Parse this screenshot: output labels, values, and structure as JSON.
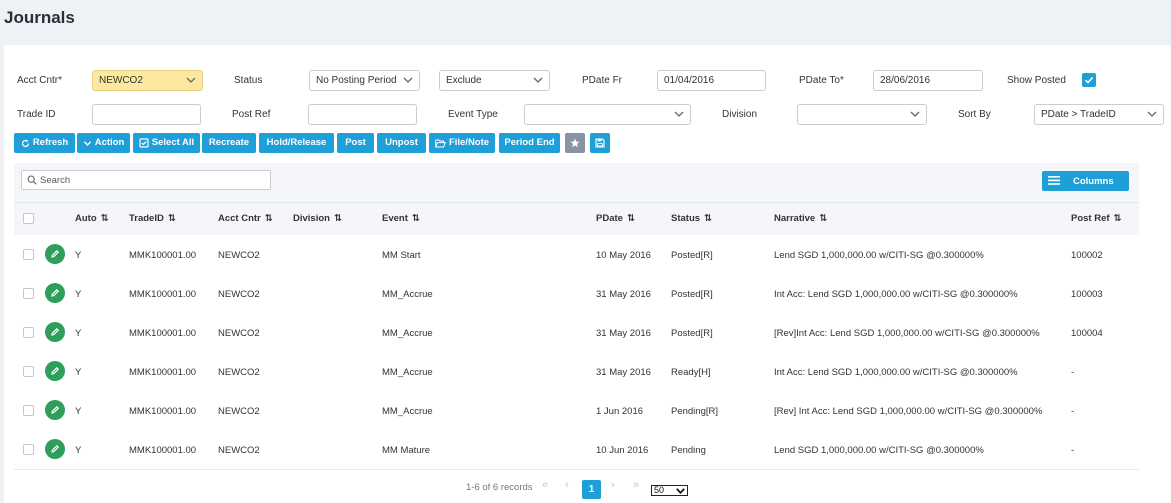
{
  "page": {
    "title": "Journals"
  },
  "filters": {
    "acct_cntr": {
      "label": "Acct Cntr*",
      "value": "NEWCO2"
    },
    "status": {
      "label": "Status",
      "value": "No Posting Period"
    },
    "exclude": {
      "value": "Exclude"
    },
    "pdate_fr": {
      "label": "PDate Fr",
      "value": "01/04/2016"
    },
    "pdate_to": {
      "label": "PDate To*",
      "value": "28/06/2016"
    },
    "show_posted": {
      "label": "Show Posted",
      "checked": true
    },
    "trade_id": {
      "label": "Trade ID",
      "value": ""
    },
    "post_ref": {
      "label": "Post Ref",
      "value": ""
    },
    "event_type": {
      "label": "Event Type",
      "value": ""
    },
    "division": {
      "label": "Division",
      "value": ""
    },
    "sort_by": {
      "label": "Sort By",
      "value": "PDate > TradeID"
    }
  },
  "toolbar": {
    "refresh": "Refresh",
    "action": "Action",
    "select_all": "Select All",
    "recreate": "Recreate",
    "hold_release": "Hold/Release",
    "post": "Post",
    "unpost": "Unpost",
    "file_note": "File/Note",
    "period_end": "Period End"
  },
  "grid": {
    "search_placeholder": "Search",
    "columns_label": "Columns",
    "headers": {
      "auto": "Auto",
      "trade_id": "TradeID",
      "acct_cntr": "Acct Cntr",
      "division": "Division",
      "event": "Event",
      "pdate": "PDate",
      "status": "Status",
      "narrative": "Narrative",
      "post_ref": "Post Ref"
    },
    "rows": [
      {
        "auto": "Y",
        "trade_id": "MMK100001.00",
        "acct_cntr": "NEWCO2",
        "division": "",
        "event": "MM Start",
        "pdate": "10 May 2016",
        "status": "Posted[R]",
        "narrative": "Lend SGD 1,000,000.00 w/CITI-SG @0.300000%",
        "post_ref": "100002"
      },
      {
        "auto": "Y",
        "trade_id": "MMK100001.00",
        "acct_cntr": "NEWCO2",
        "division": "",
        "event": "MM_Accrue",
        "pdate": "31 May 2016",
        "status": "Posted[R]",
        "narrative": "Int Acc: Lend SGD 1,000,000.00 w/CITI-SG @0.300000%",
        "post_ref": "100003"
      },
      {
        "auto": "Y",
        "trade_id": "MMK100001.00",
        "acct_cntr": "NEWCO2",
        "division": "",
        "event": "MM_Accrue",
        "pdate": "31 May 2016",
        "status": "Posted[R]",
        "narrative": "[Rev]Int Acc: Lend SGD 1,000,000.00 w/CITI-SG @0.300000%",
        "post_ref": "100004"
      },
      {
        "auto": "Y",
        "trade_id": "MMK100001.00",
        "acct_cntr": "NEWCO2",
        "division": "",
        "event": "MM_Accrue",
        "pdate": "31 May 2016",
        "status": "Ready[H]",
        "narrative": "Int Acc: Lend SGD 1,000,000.00 w/CITI-SG @0.300000%",
        "post_ref": "-"
      },
      {
        "auto": "Y",
        "trade_id": "MMK100001.00",
        "acct_cntr": "NEWCO2",
        "division": "",
        "event": "MM_Accrue",
        "pdate": "1 Jun 2016",
        "status": "Pending[R]",
        "narrative": "[Rev] Int Acc: Lend SGD 1,000,000.00 w/CITI-SG @0.300000%",
        "post_ref": "-"
      },
      {
        "auto": "Y",
        "trade_id": "MMK100001.00",
        "acct_cntr": "NEWCO2",
        "division": "",
        "event": "MM Mature",
        "pdate": "10 Jun 2016",
        "status": "Pending",
        "narrative": "Lend SGD 1,000,000.00 w/CITI-SG @0.300000%",
        "post_ref": "-"
      }
    ]
  },
  "pagination": {
    "summary": "1-6 of 6 records",
    "first": "«",
    "prev": "‹",
    "current": "1",
    "next": "›",
    "last": "»",
    "page_size": "50"
  },
  "colors": {
    "accent": "#1e9fd8",
    "edit": "#2e9e5b",
    "highlight": "#fde8a0"
  }
}
